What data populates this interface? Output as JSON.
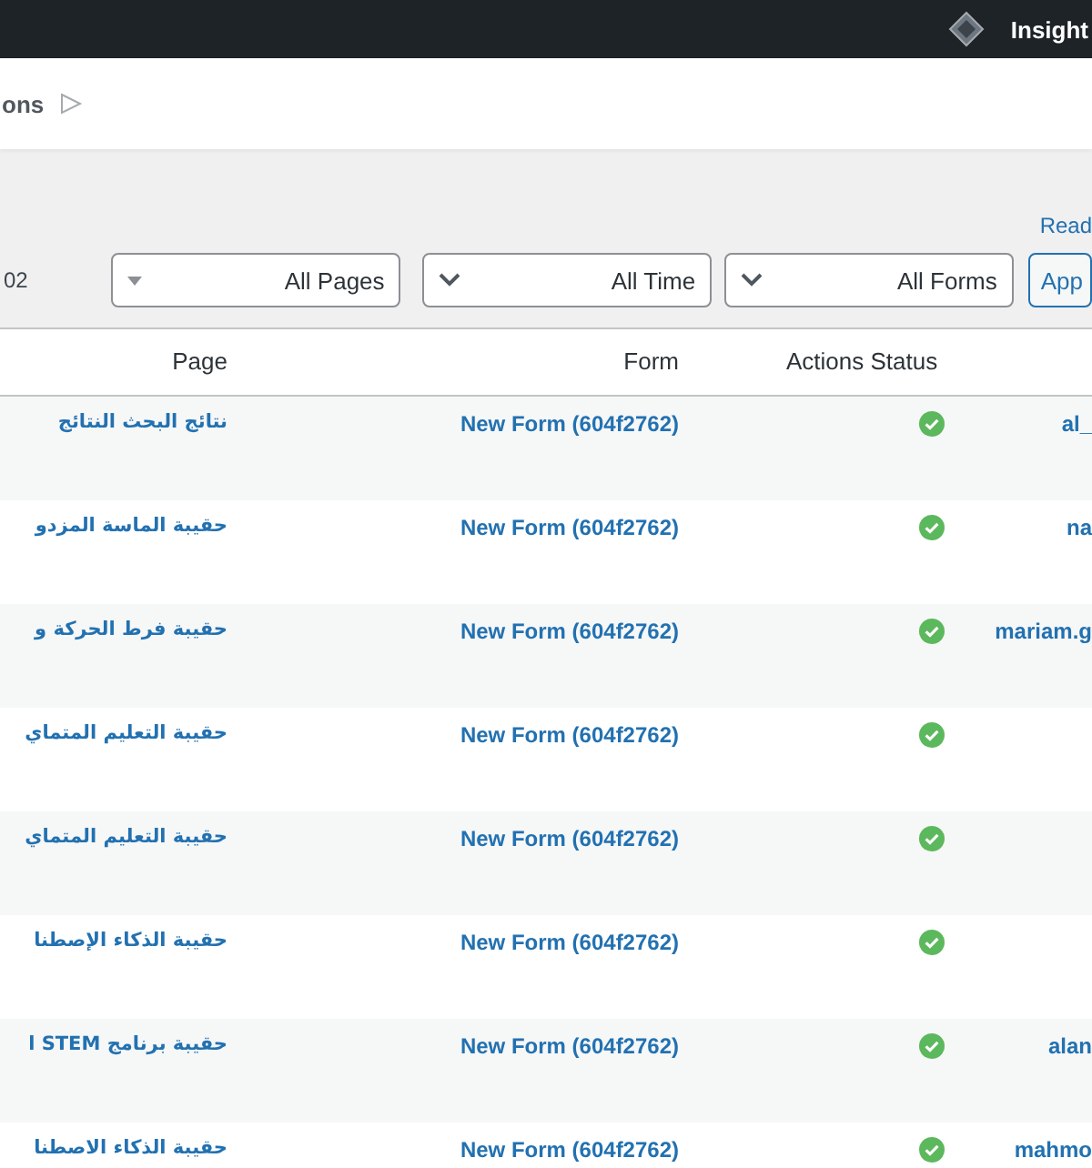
{
  "admin_bar": {
    "site_name": "Insight"
  },
  "header": {
    "title": "ons"
  },
  "read_link": "Read",
  "filters": {
    "count": "02",
    "selects": [
      {
        "kind": "triangle",
        "value": "All Pages"
      },
      {
        "kind": "chevron",
        "value": "All Time"
      },
      {
        "kind": "chevron",
        "value": "All Forms"
      }
    ],
    "apply_button": "App"
  },
  "table": {
    "columns": [
      "Page",
      "Form",
      "Actions Status"
    ],
    "rows": [
      {
        "page": "نتائج البحث النتائج",
        "form": "New Form (604f2762)",
        "success": true,
        "user": "al_"
      },
      {
        "page": "حقيبة الماسة المزدو",
        "form": "New Form (604f2762)",
        "success": true,
        "user": "na"
      },
      {
        "page": "حقيبة فرط الحركة و",
        "form": "New Form (604f2762)",
        "success": true,
        "user": "mariam.g"
      },
      {
        "page": "حقيبة التعليم المتماي",
        "form": "New Form (604f2762)",
        "success": true,
        "user": ""
      },
      {
        "page": "حقيبة التعليم المتماي",
        "form": "New Form (604f2762)",
        "success": true,
        "user": ""
      },
      {
        "page": "حقيبة الذكاء الإصطنا",
        "form": "New Form (604f2762)",
        "success": true,
        "user": ""
      },
      {
        "page": "حقيبة برنامج l STEM",
        "form": "New Form (604f2762)",
        "success": true,
        "user": "alan"
      },
      {
        "page": "حقيبة الذكاء الاصطنا",
        "form": "New Form (604f2762)",
        "success": true,
        "user": "mahmo"
      }
    ]
  }
}
